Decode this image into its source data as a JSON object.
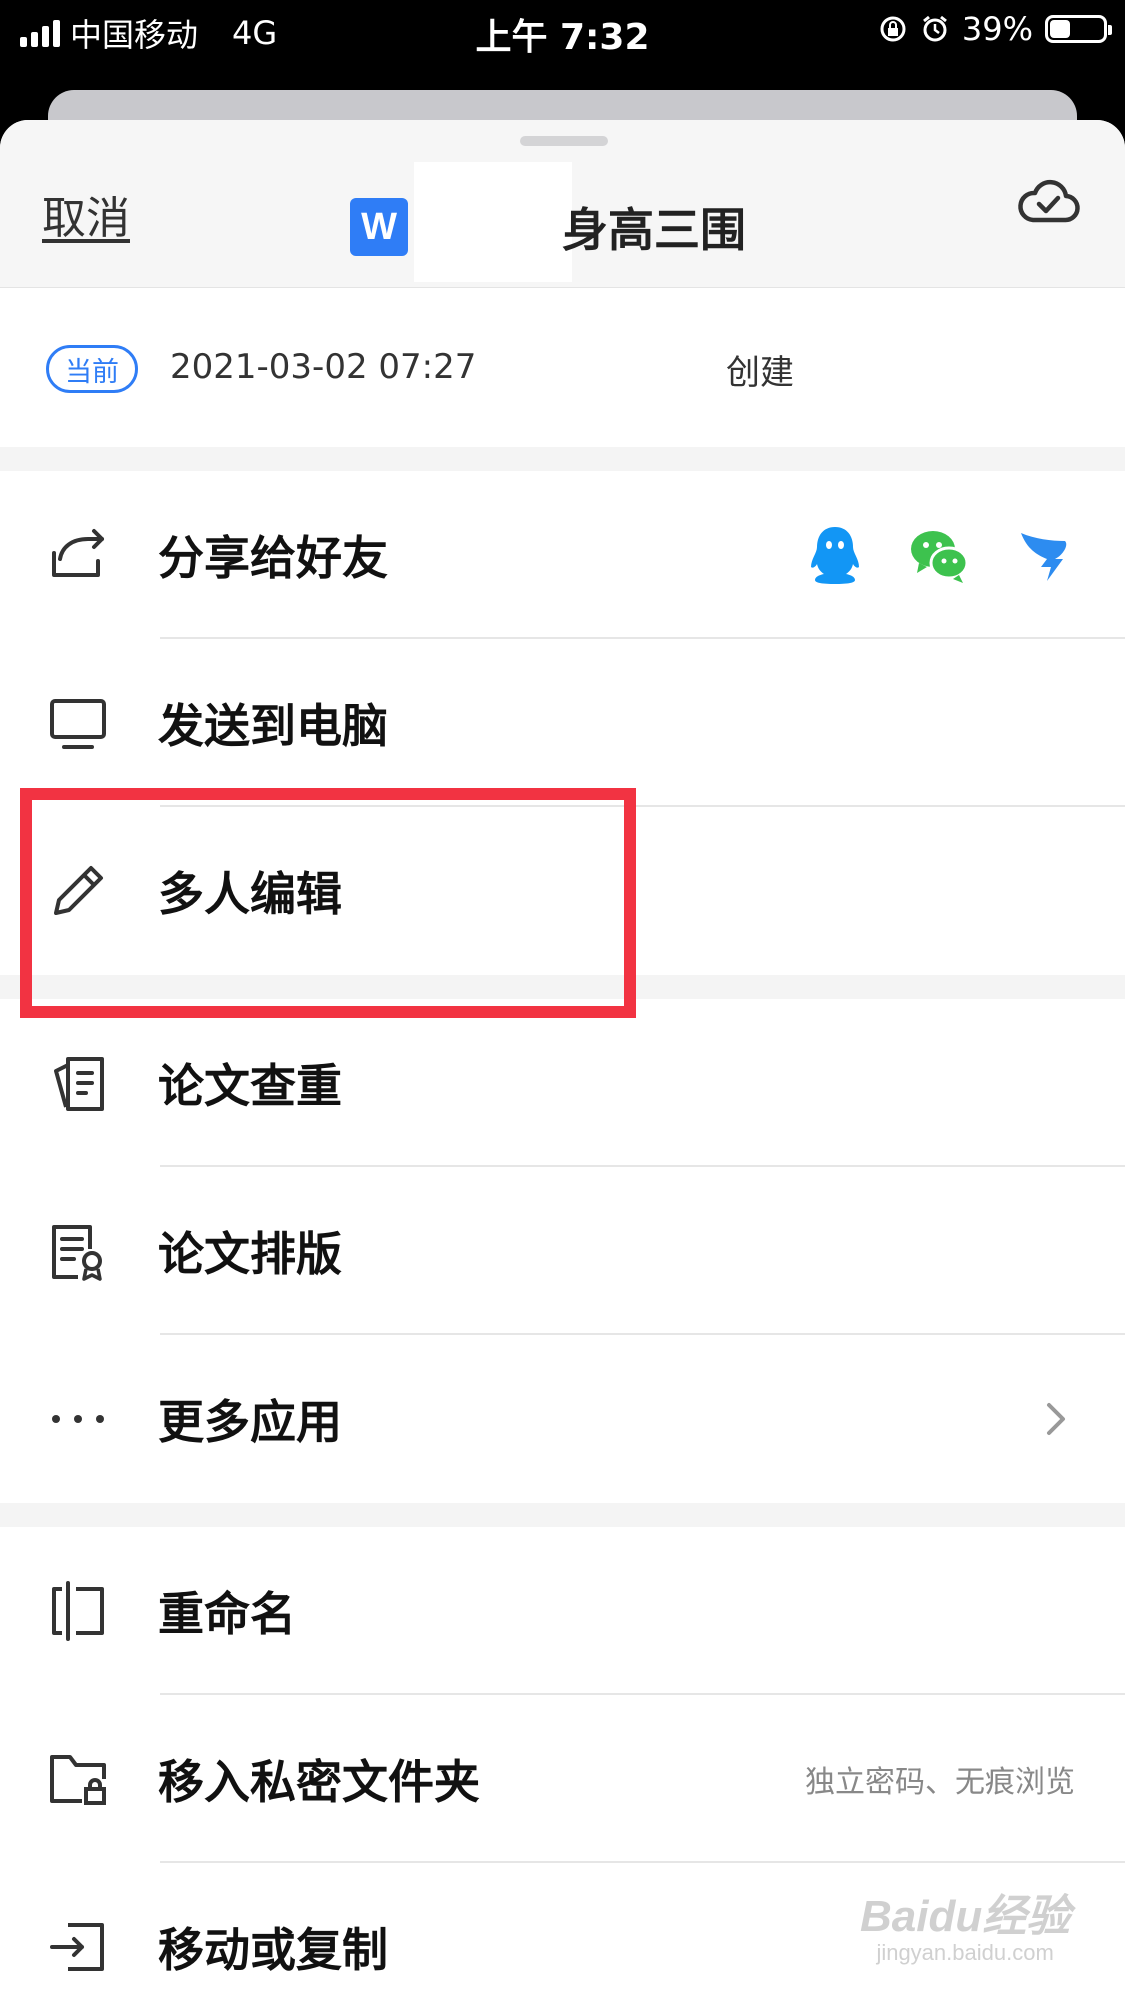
{
  "status_bar": {
    "carrier": "中国移动",
    "network": "4G",
    "time": "上午 7:32",
    "battery_percent": "39%",
    "battery_level": 0.39
  },
  "header": {
    "cancel_label": "取消",
    "doc_icon_letter": "W",
    "doc_title": "身高三围"
  },
  "version": {
    "badge": "当前",
    "date": "2021-03-02 07:27",
    "creator_suffix": "创建"
  },
  "menu": {
    "share": {
      "label": "分享给好友",
      "targets": [
        "qq-icon",
        "wechat-icon",
        "dingtalk-icon"
      ]
    },
    "send_pc": {
      "label": "发送到电脑"
    },
    "collab_edit": {
      "label": "多人编辑"
    },
    "paper_check": {
      "label": "论文查重"
    },
    "paper_format": {
      "label": "论文排版"
    },
    "more_apps": {
      "label": "更多应用"
    },
    "rename": {
      "label": "重命名"
    },
    "private_folder": {
      "label": "移入私密文件夹",
      "hint": "独立密码、无痕浏览"
    },
    "move_copy": {
      "label": "移动或复制"
    }
  },
  "watermark": {
    "text": "Baidu经验",
    "sub": "jingyan.baidu.com"
  },
  "colors": {
    "accent": "#2f7df6",
    "highlight": "#f23342",
    "qq": "#1296f5",
    "wechat": "#3dc24e",
    "dingtalk": "#2d8cf0"
  }
}
